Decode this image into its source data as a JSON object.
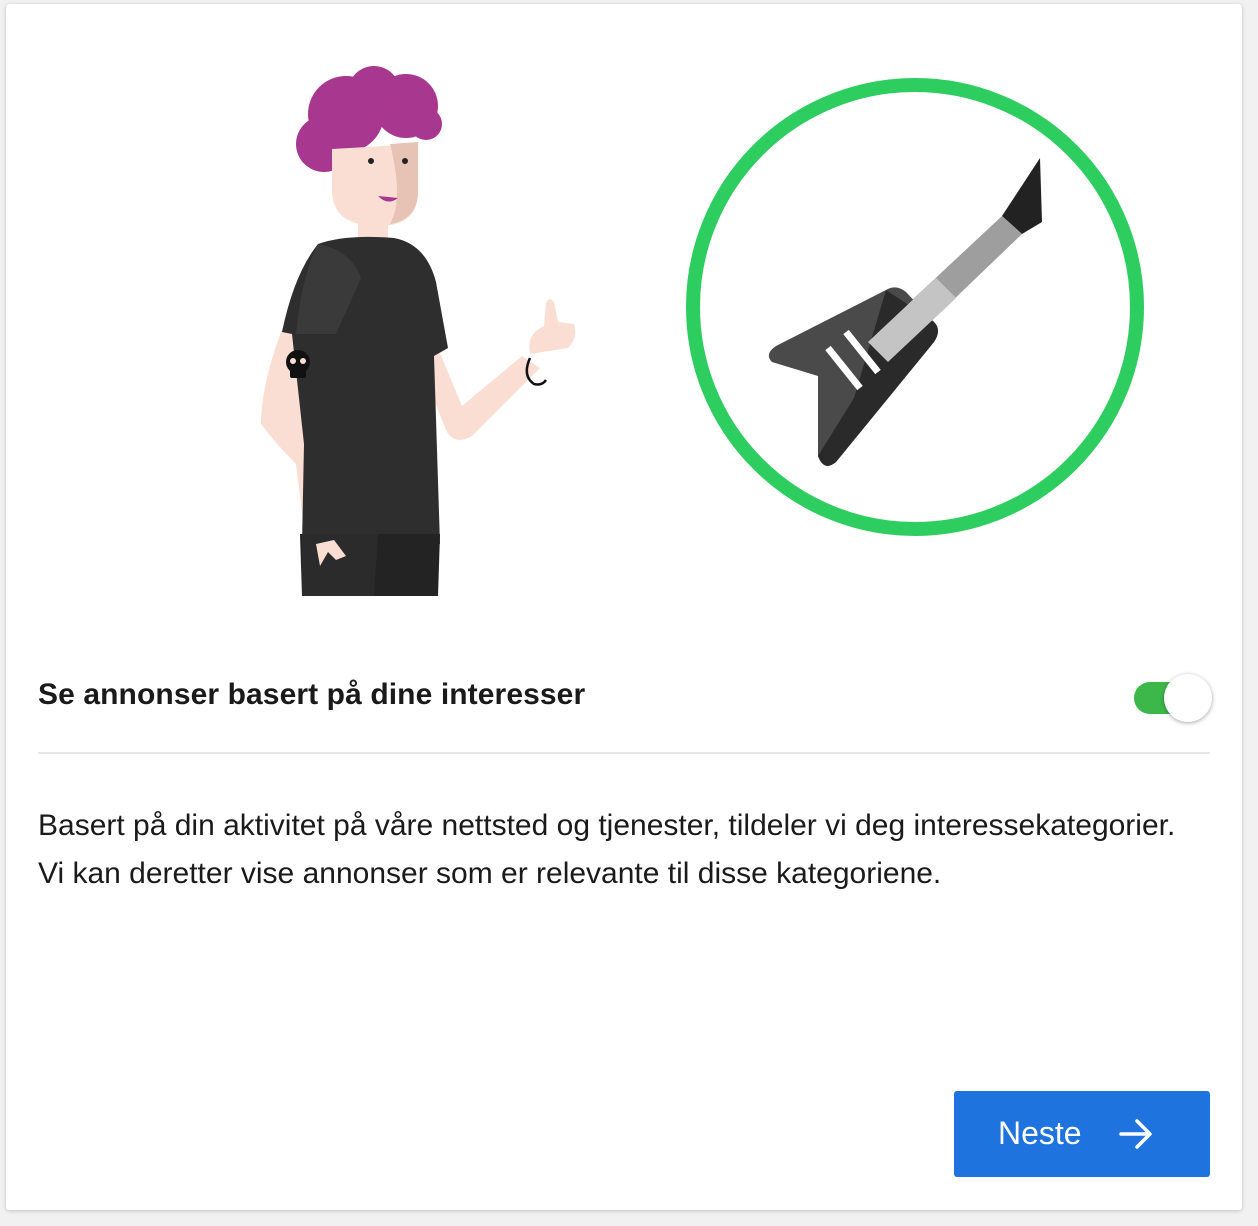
{
  "illustration": {
    "person_icon": "person-thumbs-up-icon",
    "guitar_icon": "electric-guitar-icon",
    "circle_color": "#2dcd5f",
    "hair_color": "#a8378f"
  },
  "setting": {
    "label": "Se annonser basert på dine interesser",
    "toggle_state": "on",
    "toggle_color": "#3cb84a"
  },
  "description": {
    "text": "Basert på din aktivitet på våre nettsted og tjenester, tildeler vi deg interessekategorier. Vi kan deretter vise annonser som er relevante til disse kategoriene."
  },
  "actions": {
    "next_label": "Neste",
    "next_icon": "arrow-right-icon",
    "button_color": "#1f73de"
  }
}
